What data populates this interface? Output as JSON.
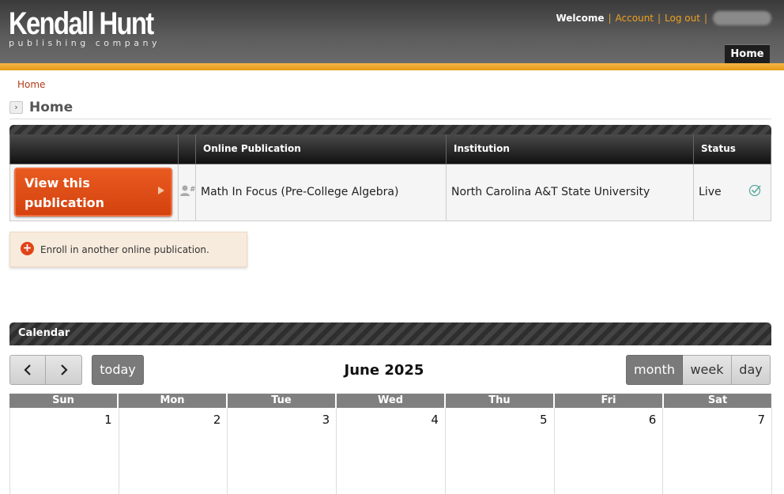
{
  "logo": {
    "main": "Kendall Hunt",
    "sub": "publishing company"
  },
  "topnav": {
    "welcome": "Welcome",
    "account": "Account",
    "logout": "Log out",
    "separator": "|"
  },
  "nav_tab": "Home",
  "breadcrumb": "Home",
  "page_title": "Home",
  "table": {
    "headers": [
      "",
      "",
      "Online Publication",
      "Institution",
      "Status"
    ],
    "rows": [
      {
        "button": "View this publication",
        "publication": "Math In Focus (Pre-College Algebra)",
        "institution": "North Carolina A&T State University",
        "status": "Live"
      }
    ]
  },
  "enroll_text": "Enroll in another online publication.",
  "calendar": {
    "header": "Calendar",
    "title": "June 2025",
    "today": "today",
    "views": {
      "month": "month",
      "week": "week",
      "day": "day"
    },
    "active_view": "month",
    "days_of_week": [
      "Sun",
      "Mon",
      "Tue",
      "Wed",
      "Thu",
      "Fri",
      "Sat"
    ],
    "first_week": [
      "1",
      "2",
      "3",
      "4",
      "5",
      "6",
      "7"
    ]
  },
  "colors": {
    "accent_orange": "#e39a17",
    "button_orange": "#e04c14",
    "link": "#b03a16"
  }
}
